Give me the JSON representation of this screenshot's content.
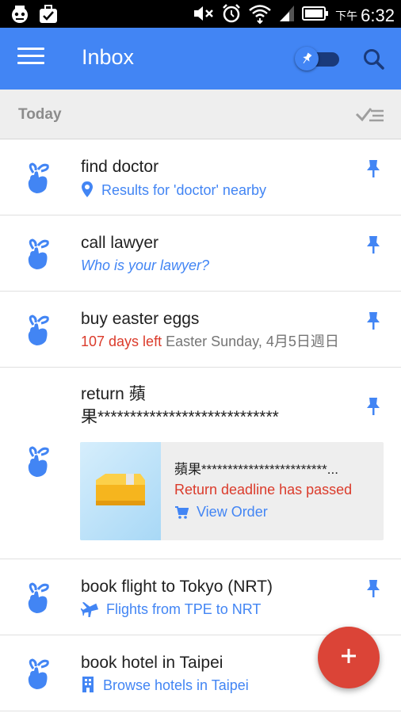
{
  "status_bar": {
    "time": "6:32",
    "ampm": "下午",
    "icons": [
      "robot-icon",
      "briefcase-check-icon",
      "mute-icon",
      "alarm-icon",
      "wifi-icon",
      "signal-icon",
      "battery-icon"
    ]
  },
  "app_bar": {
    "title": "Inbox",
    "icons": [
      "menu-icon",
      "pin-toggle-icon",
      "search-icon"
    ]
  },
  "section": {
    "title": "Today",
    "action_icon": "sweep-check-icon"
  },
  "items": [
    {
      "title": "find doctor",
      "subtitle_icon": "location-pin-icon",
      "subtitle": "Results for 'doctor' nearby",
      "pinned": true
    },
    {
      "title": "call lawyer",
      "subtitle": "Who is your lawyer?",
      "pinned": true
    },
    {
      "title": "buy easter eggs",
      "due_text": "107 days left",
      "event_text": "Easter Sunday, 4月5日週日",
      "pinned": true
    },
    {
      "title_line1": "return 蘋",
      "title_line2": "果****************************",
      "pinned": true,
      "card": {
        "product_name": "蘋果************************...",
        "status": "Return deadline has passed",
        "action_icon": "cart-icon",
        "action_label": "View Order"
      }
    },
    {
      "title": "book flight to Tokyo (NRT)",
      "subtitle_icon": "airplane-icon",
      "subtitle": "Flights from TPE to NRT",
      "pinned": true
    },
    {
      "title": "book hotel in Taipei",
      "subtitle_icon": "hotel-building-icon",
      "subtitle": "Browse hotels in Taipei",
      "pinned": false
    }
  ],
  "fab": {
    "icon": "plus-icon"
  },
  "colors": {
    "primary": "#4285f4",
    "fab": "#db4437",
    "due_red": "#db3b2b",
    "section_bg": "#eeeeee"
  }
}
